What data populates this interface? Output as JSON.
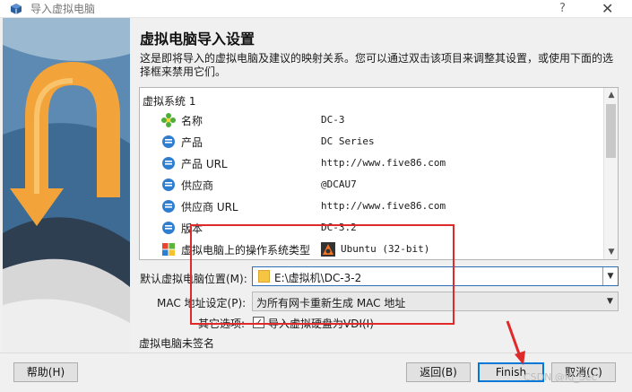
{
  "window": {
    "title": "导入虚拟电脑",
    "help_glyph": "?",
    "close_glyph": "✕"
  },
  "page": {
    "heading": "虚拟电脑导入设置",
    "description": "这是即将导入的虚拟电脑及建议的映射关系。您可以通过双击该项目来调整其设置，或使用下面的选择框来禁用它们。"
  },
  "tree": {
    "group": "虚拟系统 1",
    "rows": [
      {
        "icon": "name-icon",
        "label": "名称",
        "value": "DC-3"
      },
      {
        "icon": "info-bubble-icon",
        "label": "产品",
        "value": "DC Series"
      },
      {
        "icon": "info-bubble-icon",
        "label": "产品 URL",
        "value": "http://www.five86.com"
      },
      {
        "icon": "info-bubble-icon",
        "label": "供应商",
        "value": "@DCAU7"
      },
      {
        "icon": "info-bubble-icon",
        "label": "供应商 URL",
        "value": "http://www.five86.com"
      },
      {
        "icon": "info-bubble-icon",
        "label": "版本",
        "value": "DC-3.2"
      },
      {
        "icon": "os-type-icon",
        "label": "虚拟电脑上的操作系统类型",
        "value": "Ubuntu (32-bit)",
        "value_icon": "ubuntu-icon"
      }
    ]
  },
  "settings": {
    "folder_label": "默认虚拟电脑位置(M):",
    "folder_value": "E:\\虚拟机\\DC-3-2",
    "mac_label": "MAC 地址设定(P):",
    "mac_value": "为所有网卡重新生成 MAC 地址",
    "other_label": "其它选项:",
    "import_vdi_label": "导入虚拟硬盘为VDI(I)",
    "import_vdi_checked": "✓"
  },
  "status": {
    "unsigned": "虚拟电脑未签名"
  },
  "buttons": {
    "help": "帮助(H)",
    "back": "返回(B)",
    "finish": "Finish",
    "cancel": "取消(C)"
  },
  "watermark": "CSDN @KJ_Sec",
  "colors": {
    "annotation_red": "#e02a2a",
    "focus_blue": "#0078d7",
    "wizard_orange": "#f2a43a",
    "wizard_sky": "#3f6f98"
  }
}
